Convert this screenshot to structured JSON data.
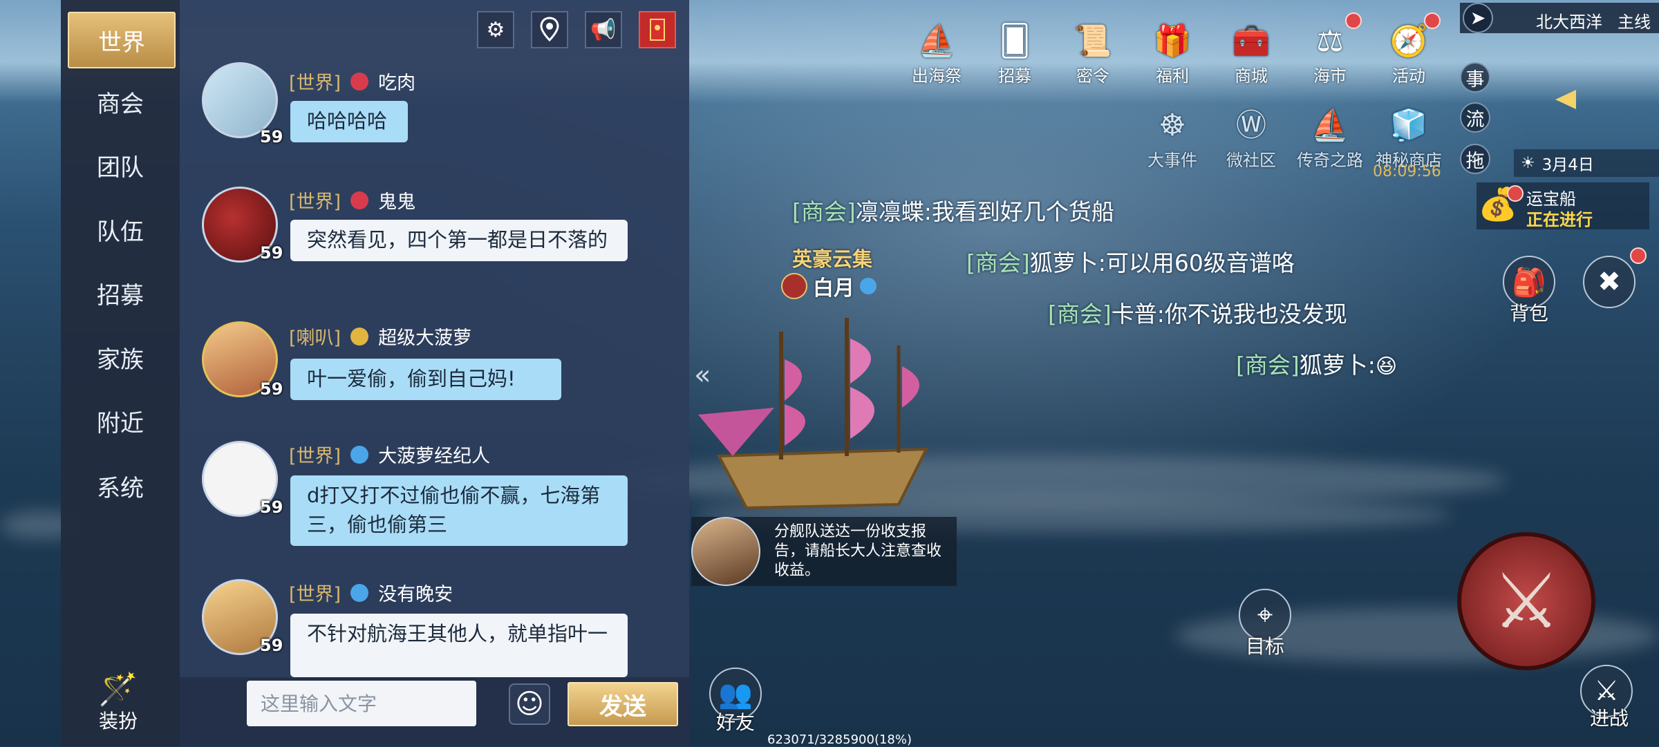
{
  "nav": {
    "items": [
      {
        "label": "世界",
        "active": true
      },
      {
        "label": "商会"
      },
      {
        "label": "团队"
      },
      {
        "label": "队伍"
      },
      {
        "label": "招募"
      },
      {
        "label": "家族"
      },
      {
        "label": "附近"
      },
      {
        "label": "系统"
      }
    ],
    "dress_label": "装扮"
  },
  "chat": {
    "top_icons": [
      "gear-icon",
      "location-pin-icon",
      "megaphone-icon",
      "red-envelope-icon"
    ],
    "messages": [
      {
        "channel": "[世界]",
        "name": "吃肉",
        "level": "59",
        "text": "哈哈哈哈"
      },
      {
        "channel": "[世界]",
        "name": "鬼鬼",
        "level": "59",
        "text": "突然看见，四个第一都是日不落的"
      },
      {
        "channel": "[喇叭]",
        "name": "超级大菠萝",
        "level": "59",
        "text": "叶一爱偷，偷到自己妈!"
      },
      {
        "channel": "[世界]",
        "name": "大菠萝经纪人",
        "level": "59",
        "text": "d打又打不过偷也偷不赢，七海第三，偷也偷第三"
      },
      {
        "channel": "[世界]",
        "name": "没有晚安",
        "level": "59",
        "text": "不针对航海王其他人，就单指叶一"
      }
    ],
    "input_placeholder": "这里输入文字",
    "send_label": "发送"
  },
  "hud": {
    "top_row": [
      {
        "label": "出海祭",
        "icon": "ship-icon"
      },
      {
        "label": "招募",
        "icon": "card-icon"
      },
      {
        "label": "密令",
        "icon": "scroll-icon"
      },
      {
        "label": "福利",
        "icon": "gift-icon"
      },
      {
        "label": "商城",
        "icon": "chest-icon"
      },
      {
        "label": "海市",
        "icon": "scale-icon"
      },
      {
        "label": "活动",
        "icon": "compass-icon"
      }
    ],
    "second_row": [
      {
        "label": "大事件",
        "icon": "helm-icon"
      },
      {
        "label": "微社区",
        "icon": "w-badge-icon"
      },
      {
        "label": "传奇之路",
        "icon": "sail-icon"
      },
      {
        "label": "神秘商店",
        "icon": "cubes-icon"
      }
    ],
    "shop_timer": "08:09:56",
    "location": "北大西洋",
    "mainline_label": "主线",
    "side_buttons": [
      "事",
      "流",
      "拖"
    ],
    "date": "3月4日",
    "treasure_ship": {
      "title": "运宝船",
      "status": "正在进行"
    },
    "bag_label": "背包",
    "target_label": "目标",
    "friends_label": "好友",
    "battle_label": "进战",
    "progress_text": "623071/3285900(18%)",
    "progress_fraction": 0.18
  },
  "ship": {
    "guild": "英豪云集",
    "name": "白月"
  },
  "system_messages": [
    {
      "tag": "[商会]",
      "text": "凛凛蝶:我看到好几个货船"
    },
    {
      "tag": "[商会]",
      "text": "狐萝卜:可以用60级音谱咯"
    },
    {
      "tag": "[商会]",
      "text": "卡普:你不说我也没发现"
    },
    {
      "tag": "[商会]",
      "text": "狐萝卜:"
    }
  ],
  "notice": {
    "text": "分舰队送达一份收支报告，请船长大人注意查收收益。"
  },
  "colors": {
    "gold": "#d8b86e",
    "bubble": "#a9dcf7",
    "panel": "#2e3e5c",
    "tag_green": "#a8e3b6"
  }
}
